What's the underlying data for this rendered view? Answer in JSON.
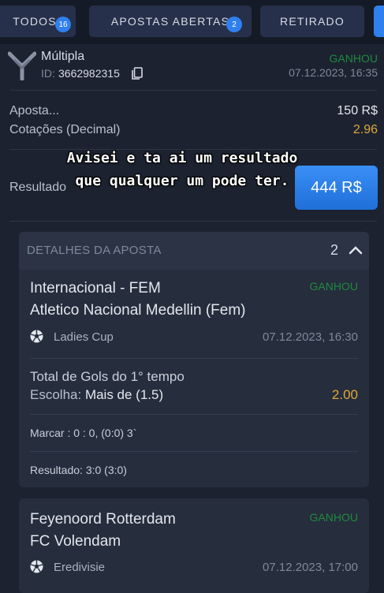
{
  "tabs": [
    {
      "label": "TODOS",
      "badge": "16"
    },
    {
      "label": "APOSTAS ABERTAS",
      "badge": "2"
    },
    {
      "label": "RETIRADO"
    }
  ],
  "bet": {
    "type": "Múltipla",
    "id_label": "ID:",
    "id": "3662982315",
    "status": "GANHOU",
    "datetime": "07.12.2023, 16:35"
  },
  "summary": {
    "stake_label": "Aposta...",
    "stake_value": "150 R$",
    "odds_label": "Cotações (Decimal)",
    "odds_value": "2.96",
    "result_label": "Resultado",
    "result_value": "444 R$"
  },
  "caption": "Avisei e ta ai um resultado que qualquer um pode ter.",
  "details": {
    "title": "DETALHES DA APOSTA",
    "count": "2",
    "events": [
      {
        "team1": "Internacional - FEM",
        "team2": "Atletico Nacional Medellin (Fem)",
        "status": "GANHOU",
        "league": "Ladies Cup",
        "datetime": "07.12.2023, 16:30",
        "market": "Total de Gols do 1° tempo",
        "choice_label": "Escolha:",
        "choice_value": "Mais de (1.5)",
        "odds": "2.00",
        "score": "Marcar : 0 : 0, (0:0) 3`",
        "result": "Resultado: 3:0 (3:0)"
      },
      {
        "team1": "Feyenoord Rotterdam",
        "team2": "FC Volendam",
        "status": "GANHOU",
        "league": "Eredivisie",
        "datetime": "07.12.2023, 17:00"
      }
    ]
  },
  "colors": {
    "accent": "#2f80ed",
    "win": "#1f8a3f",
    "odds": "#e0a83a",
    "background": "#1c2230"
  }
}
